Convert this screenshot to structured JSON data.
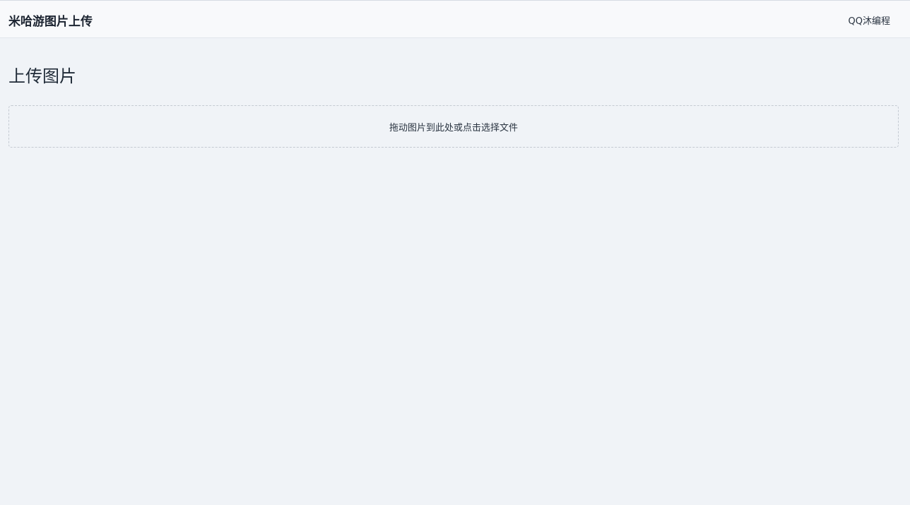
{
  "navbar": {
    "brand": "米哈游图片上传",
    "link_label": "QQ沐编程"
  },
  "main": {
    "title": "上传图片",
    "dropzone": {
      "label": "拖动图片到此处或点击选择文件"
    }
  }
}
